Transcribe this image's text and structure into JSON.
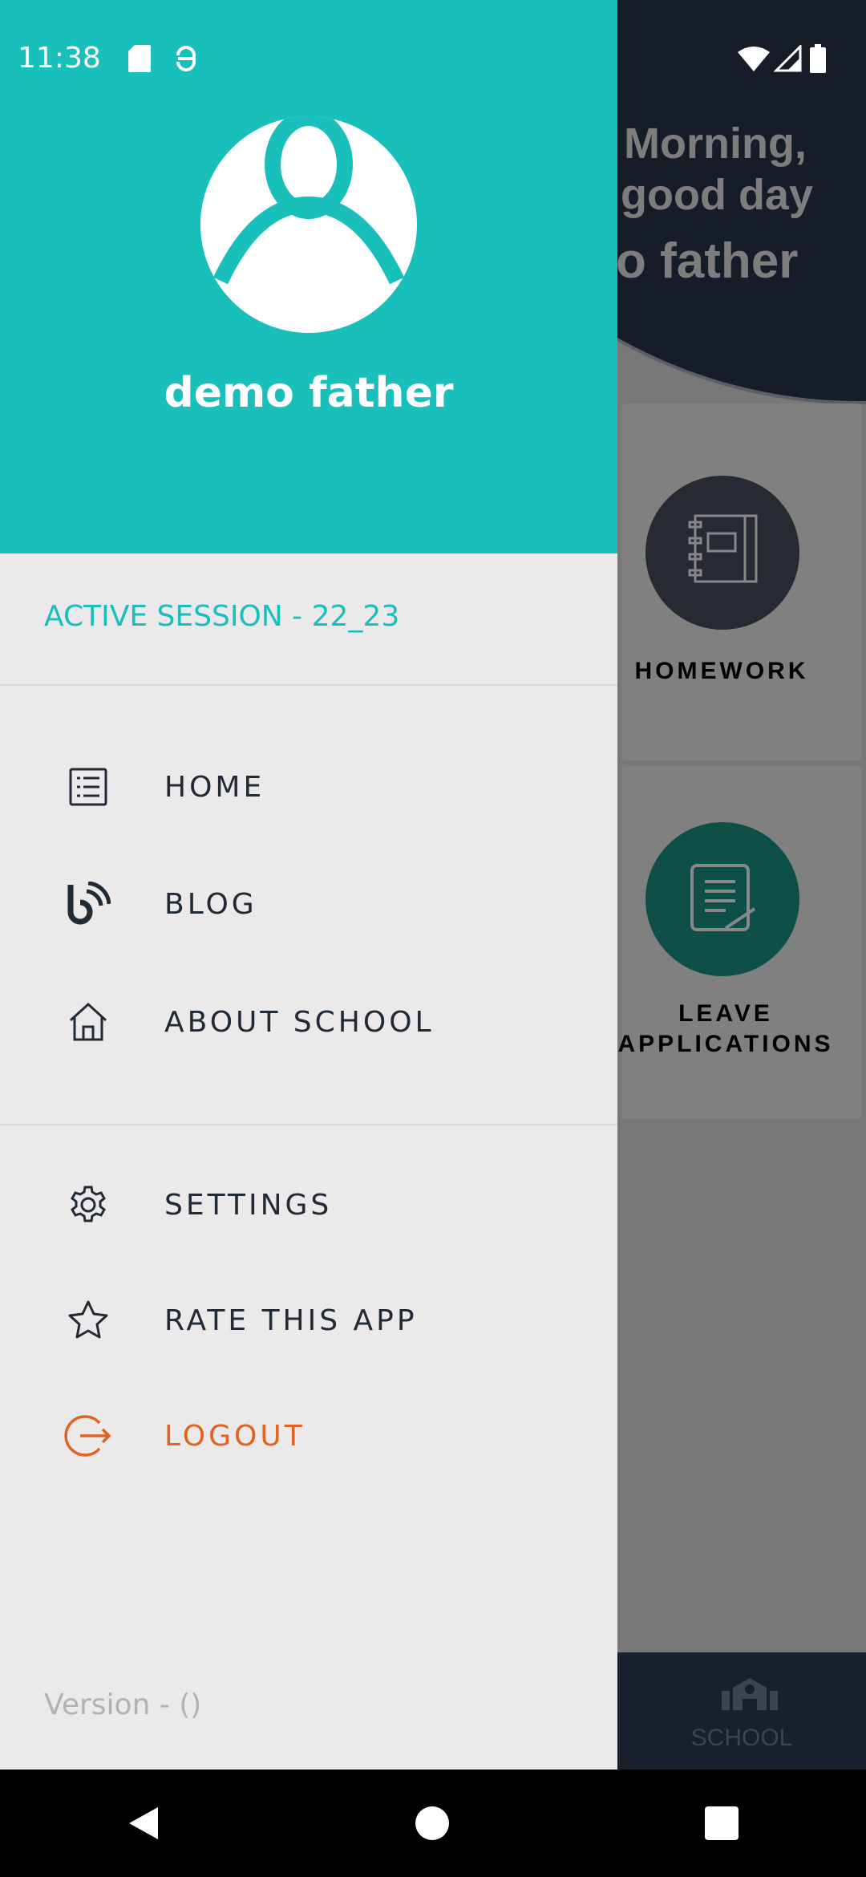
{
  "status_bar": {
    "time": "11:38",
    "icons": [
      "sd-card-icon",
      "debug-icon",
      "wifi-icon",
      "signal-icon",
      "battery-icon"
    ]
  },
  "background": {
    "greeting_line1": "Morning,",
    "greeting_line2": "good day",
    "user": "o father",
    "cards": [
      {
        "label_line1": "HOMEWORK",
        "icon": "notebook-icon",
        "color": "#282a33"
      },
      {
        "label_line1": "LEAVE",
        "label_line2": "APPLICATIONS",
        "icon": "note-edit-icon",
        "color": "#0e5047"
      }
    ],
    "bottom_nav": {
      "label": "SCHOOL",
      "icon": "school-icon"
    }
  },
  "drawer": {
    "user_name": "demo father",
    "active_session": "ACTIVE SESSION - 22_23",
    "items": [
      {
        "label": "HOME",
        "icon": "list-icon"
      },
      {
        "label": "BLOG",
        "icon": "blog-icon"
      },
      {
        "label": "ABOUT SCHOOL",
        "icon": "house-icon"
      },
      {
        "label": "SETTINGS",
        "icon": "gear-icon"
      },
      {
        "label": "RATE THIS APP",
        "icon": "star-icon"
      },
      {
        "label": "LOGOUT",
        "icon": "logout-icon"
      }
    ],
    "version": "Version -  ()",
    "colors": {
      "accent": "#19bfba",
      "logout": "#e2631f"
    }
  }
}
